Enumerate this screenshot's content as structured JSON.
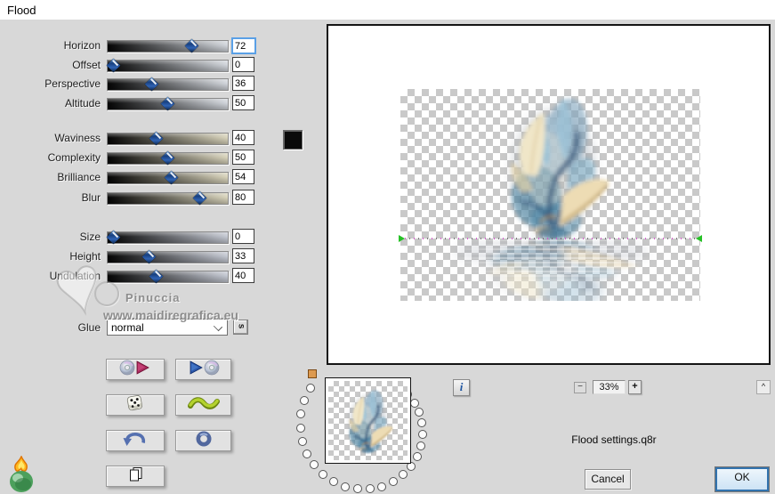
{
  "window": {
    "title": "Flood"
  },
  "sliders": {
    "rows": [
      {
        "label": "Horizon",
        "value": "72",
        "pct": 72,
        "group": 1,
        "focused": true
      },
      {
        "label": "Offset",
        "value": "0",
        "pct": 1,
        "group": 1,
        "focused": false
      },
      {
        "label": "Perspective",
        "value": "36",
        "pct": 36,
        "group": 1,
        "focused": false
      },
      {
        "label": "Altitude",
        "value": "50",
        "pct": 50,
        "group": 1,
        "focused": false
      },
      {
        "label": "Waviness",
        "value": "40",
        "pct": 40,
        "group": 2,
        "focused": false
      },
      {
        "label": "Complexity",
        "value": "50",
        "pct": 50,
        "group": 2,
        "focused": false
      },
      {
        "label": "Brilliance",
        "value": "54",
        "pct": 54,
        "group": 2,
        "focused": false
      },
      {
        "label": "Blur",
        "value": "80",
        "pct": 80,
        "group": 2,
        "focused": false
      },
      {
        "label": "Size",
        "value": "0",
        "pct": 1,
        "group": 3,
        "focused": false
      },
      {
        "label": "Height",
        "value": "33",
        "pct": 33,
        "group": 3,
        "focused": false
      },
      {
        "label": "Undulation",
        "value": "40",
        "pct": 40,
        "group": 3,
        "focused": false
      }
    ]
  },
  "swatch_color": "#0a0a0a",
  "glue": {
    "label": "Glue",
    "value": "normal",
    "s_label": "s"
  },
  "watermark": {
    "line1": "Pinuccia",
    "line2": "www.maidiregrafica.eu",
    "heart": "♥"
  },
  "tool_buttons": [
    {
      "name": "load-settings-button",
      "icon": "cd-arrow-red"
    },
    {
      "name": "save-settings-button",
      "icon": "arrow-cd-blue"
    },
    {
      "name": "random-button",
      "icon": "dice"
    },
    {
      "name": "wave-button",
      "icon": "squiggle"
    },
    {
      "name": "undo-button",
      "icon": "undo-arrow"
    },
    {
      "name": "ring-button",
      "icon": "ring"
    },
    {
      "name": "copy-button",
      "icon": "copy-pages"
    }
  ],
  "preview": {
    "zoom": "33%",
    "zoom_out": "−",
    "zoom_in": "+",
    "info": "i",
    "scroll_up": "^"
  },
  "footer": {
    "settings_name": "Flood settings.q8r",
    "cancel": "Cancel",
    "ok": "OK"
  }
}
